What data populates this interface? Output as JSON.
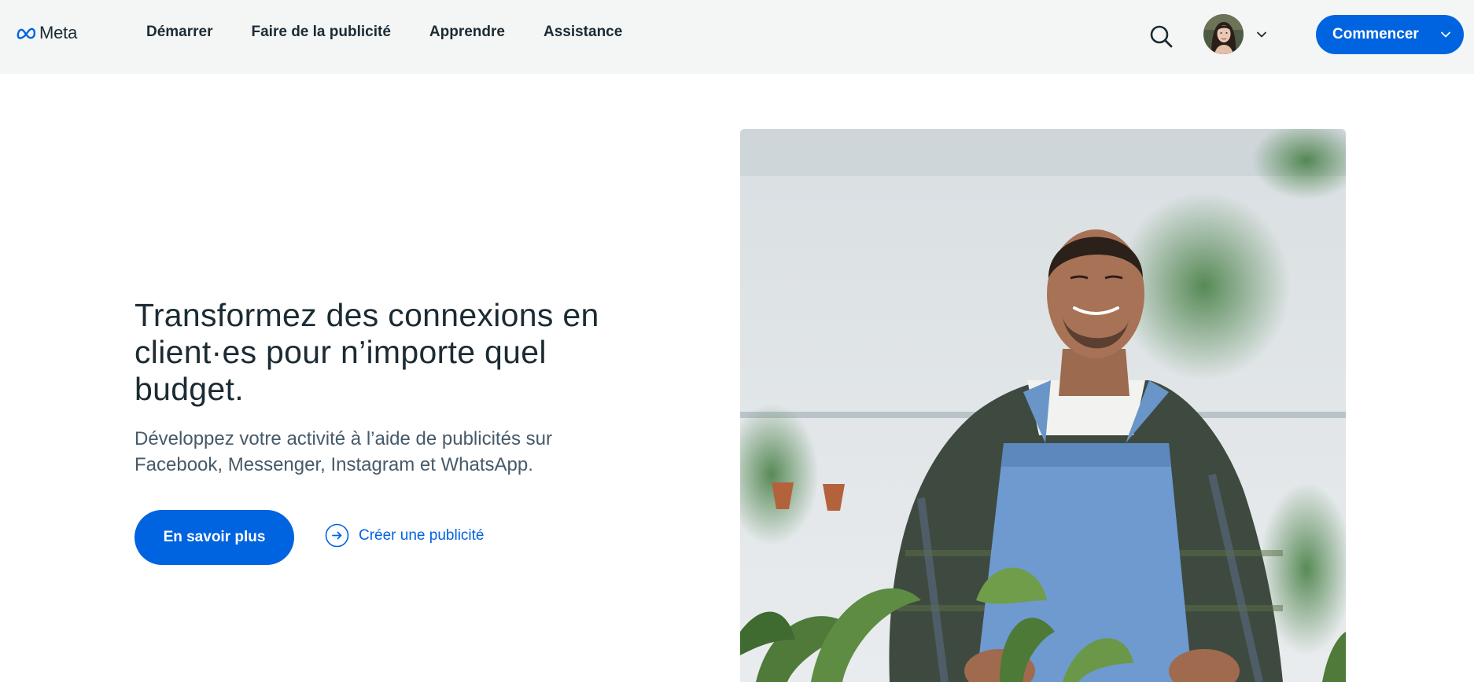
{
  "header": {
    "logo_text": "Meta",
    "nav": [
      {
        "label": "Démarrer"
      },
      {
        "label": "Faire de la publicité"
      },
      {
        "label": "Apprendre"
      },
      {
        "label": "Assistance"
      }
    ],
    "cta_label": "Commencer"
  },
  "hero": {
    "title": "Transformez des connexions en client·es pour n’importe quel budget.",
    "subtitle": "Développez votre activité à l’aide de publicités sur Facebook, Messenger, Instagram et WhatsApp.",
    "primary_button": "En savoir plus",
    "secondary_link": "Créer une publicité"
  },
  "icons": {
    "logo": "meta-infinity-logo-icon",
    "search": "search-icon",
    "account_chevron": "chevron-down-icon",
    "cta_chevron": "chevron-down-icon",
    "link_arrow": "arrow-right-circle-icon"
  },
  "colors": {
    "header_bg": "#f4f6f6",
    "brand_blue": "#0064e0",
    "text_dark": "#1c2b33",
    "text_muted": "#465a69"
  }
}
